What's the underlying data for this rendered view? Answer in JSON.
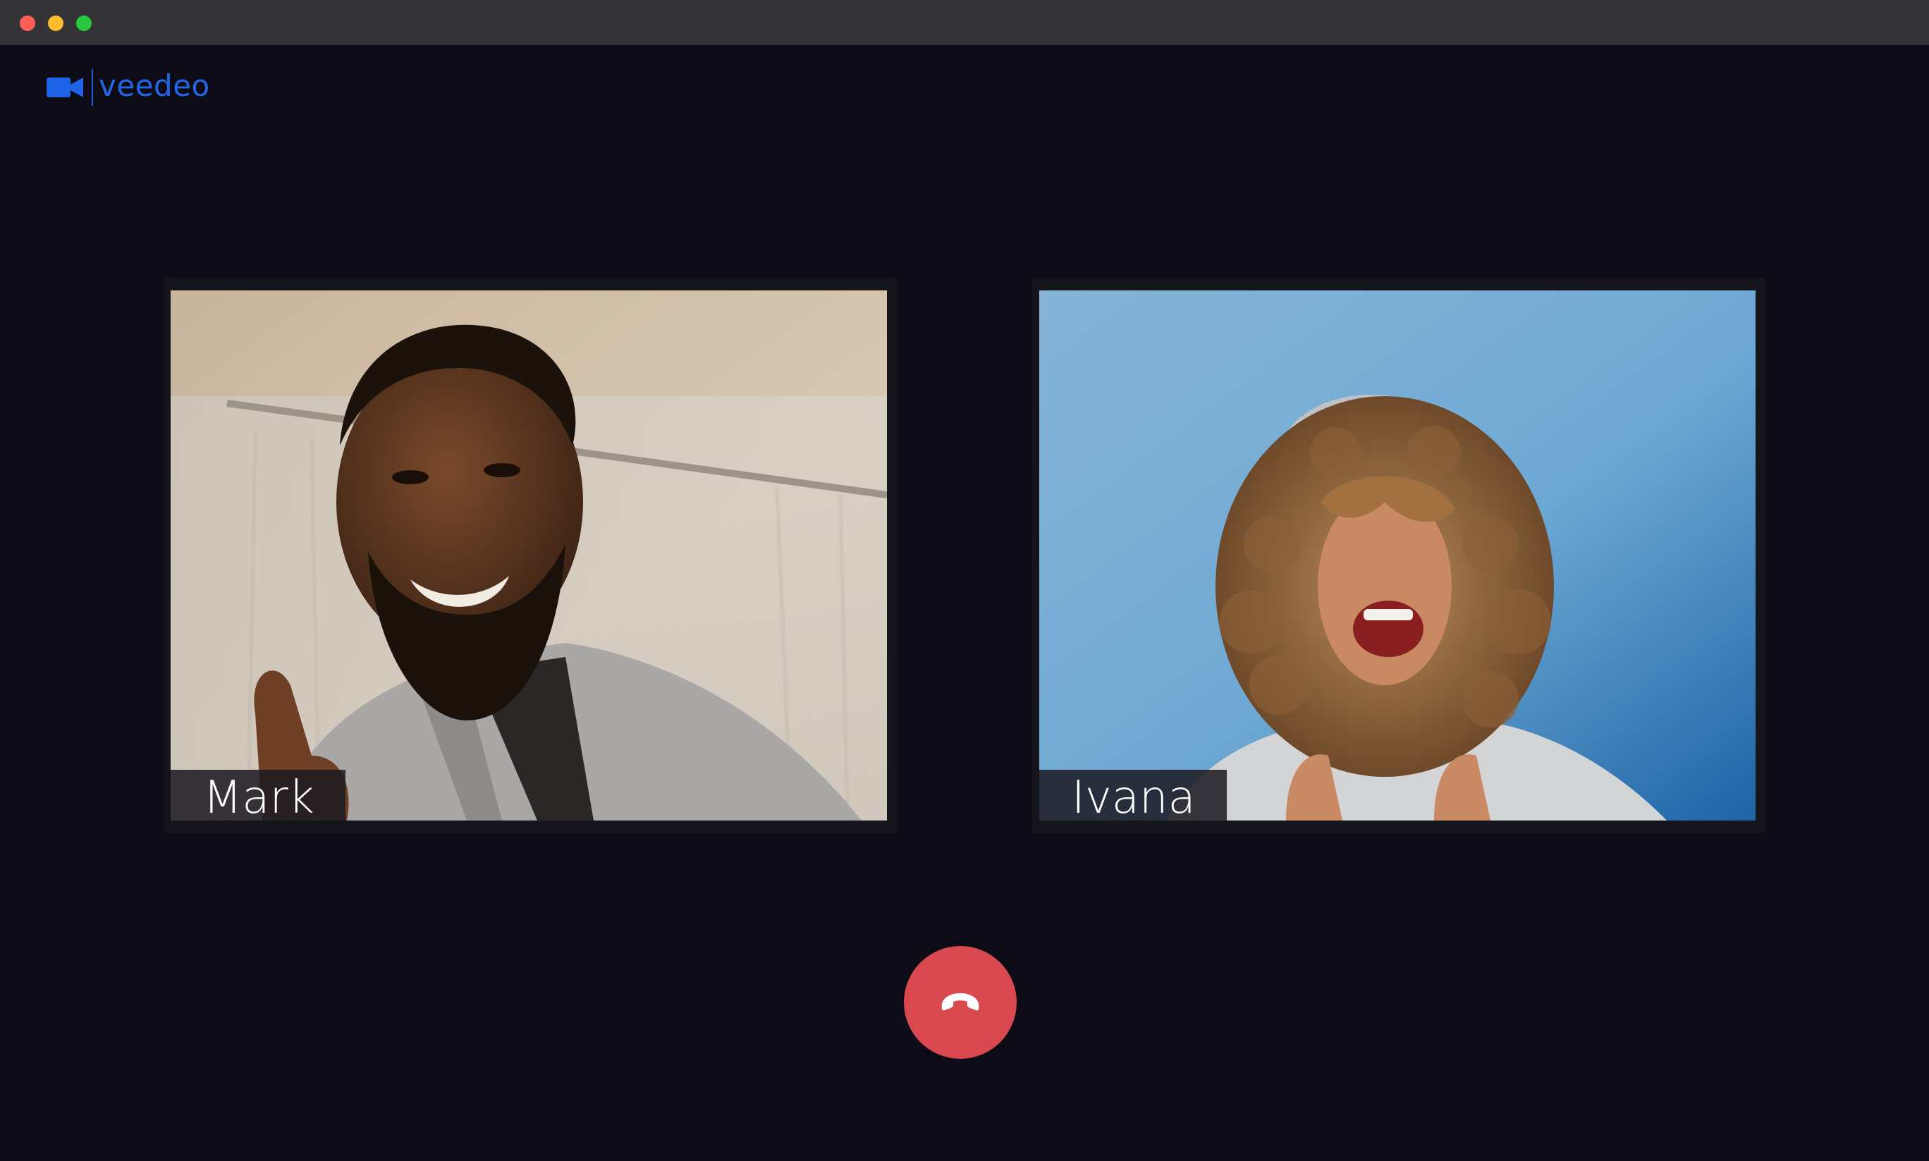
{
  "app": {
    "name": "veedeo",
    "brand_color": "#2166e6",
    "logo_icon": "video-camera-icon"
  },
  "window_controls": {
    "close_color": "#fe5f57",
    "minimize_color": "#febc2e",
    "maximize_color": "#28c840"
  },
  "participants": [
    {
      "name": "Mark"
    },
    {
      "name": "Ivana"
    }
  ],
  "controls": {
    "hangup": {
      "icon": "phone-hangup-icon",
      "color": "#d9484f"
    }
  },
  "theme": {
    "background": "#0d0c16",
    "titlebar": "#343437"
  }
}
